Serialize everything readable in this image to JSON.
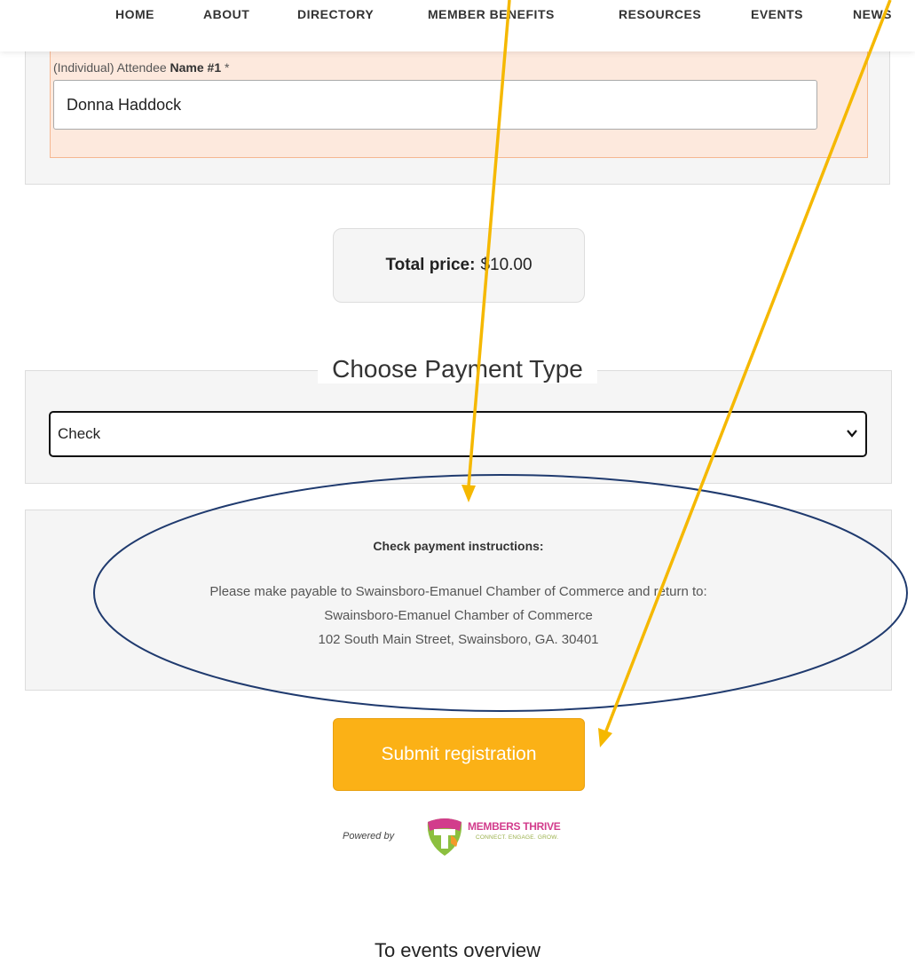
{
  "nav": {
    "items": [
      "HOME",
      "ABOUT",
      "DIRECTORY",
      "MEMBER BENEFITS",
      "RESOURCES",
      "EVENTS",
      "NEWS"
    ]
  },
  "attendee": {
    "label_prefix": "(Individual) Attendee ",
    "label_bold": "Name #1",
    "label_required": " *",
    "name_value": "Donna Haddock"
  },
  "total": {
    "label": "Total price:",
    "amount": "$10.00"
  },
  "payment": {
    "title": "Choose Payment Type",
    "selected": "Check"
  },
  "instructions": {
    "title": "Check payment instructions:",
    "line1": "Please make payable to Swainsboro-Emanuel Chamber of Commerce and return to:",
    "line2": "Swainsboro-Emanuel Chamber of Commerce",
    "line3": "102 South Main Street, Swainsboro, GA. 30401"
  },
  "submit": {
    "label": "Submit registration"
  },
  "footer": {
    "powered_by": "Powered by",
    "brand": "MEMBERS THRIVE",
    "brand_tagline": "CONNECT. ENGAGE. GROW.",
    "to_events": "To events overview"
  },
  "colors": {
    "accent": "#fbb116",
    "attendee_bg": "#fde9dd",
    "annotation_arrow": "#f5b800",
    "annotation_ellipse": "#1f3a6e"
  },
  "icons": [
    "chevron-down-icon",
    "members-thrive-logo-icon",
    "annotation-arrow-icon",
    "annotation-ellipse-icon"
  ]
}
